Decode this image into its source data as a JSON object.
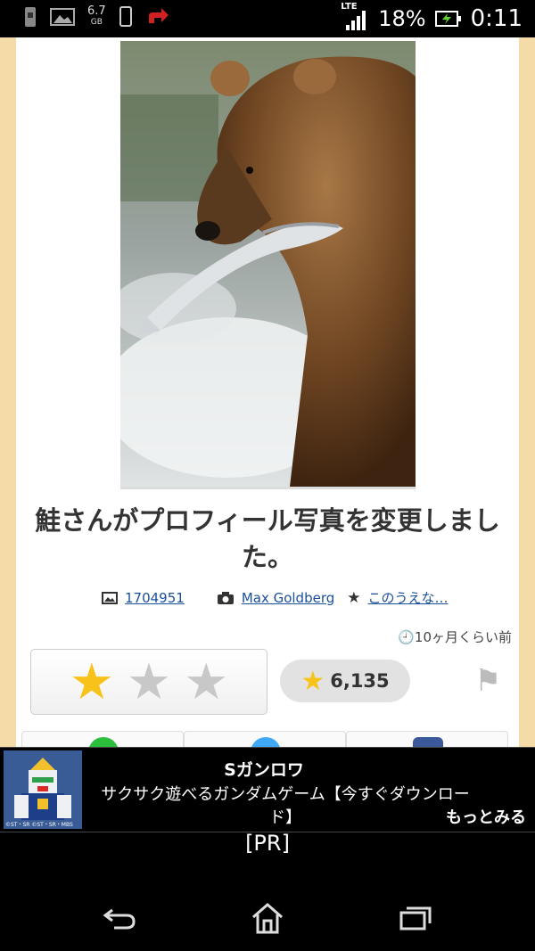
{
  "status_bar": {
    "storage_value": "6.7",
    "storage_unit": "GB",
    "network": "LTE",
    "battery_percent": "18%",
    "time": "0:11"
  },
  "post": {
    "title": "鮭さんがプロフィール写真を変更しました。",
    "image_id": "1704951",
    "photographer": "Max Goldberg",
    "source": "このうえな…",
    "time_ago": "10ヶ月くらい前",
    "rating_filled": 1,
    "rating_max": 3,
    "like_count": "6,135"
  },
  "ad": {
    "title": "Sガンロワ",
    "description": "サクサク遊べるガンダムゲーム【今すぐダウンロード】",
    "more_label": "もっとみる",
    "thumb_credit": "©ST・SR ©ST・SR・MBS",
    "pr_label": "[PR]"
  },
  "colors": {
    "page_bg": "#f4dba7",
    "star_active": "#f7c31a",
    "star_inactive": "#c8c8c8",
    "link": "#1a4f9c",
    "line_green": "#2bbf3c",
    "twitter_blue": "#3fa9f5",
    "facebook_blue": "#3b5998"
  },
  "icons": {
    "status_left": [
      "sim-icon",
      "gallery-icon",
      "phone-icon",
      "upload-icon"
    ],
    "status_right": [
      "signal-icon",
      "battery-charging-icon"
    ],
    "meta": [
      "image-icon",
      "camera-icon",
      "star-icon"
    ],
    "navigation": [
      "back-icon",
      "home-icon",
      "recent-apps-icon"
    ]
  }
}
